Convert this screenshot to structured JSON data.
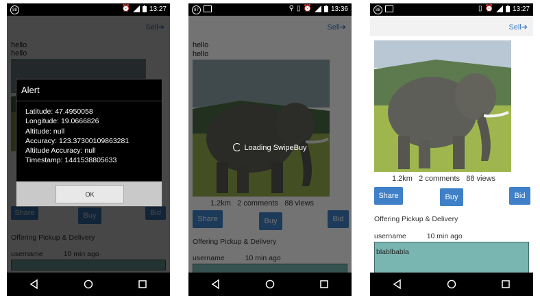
{
  "status": {
    "phone1": {
      "badge": "88",
      "time": "13:27"
    },
    "phone2": {
      "badge": "87",
      "time": "13:36"
    },
    "phone3": {
      "badge": "88",
      "time": "13:27"
    }
  },
  "header": {
    "sell_label": "Sell➔"
  },
  "feed": {
    "hello_lines": [
      "hello",
      "hello"
    ],
    "stats_distance": "1.2km",
    "stats_comments": "2 comments",
    "stats_views": "88 views",
    "share_label": "Share",
    "buy_label": "Buy",
    "bid_label": "Bid",
    "offering": "Offering Pickup & Delivery",
    "username": "username",
    "time_ago": "10 min ago",
    "comment_text": "blablbabla"
  },
  "alert": {
    "title": "Alert",
    "lines": [
      "Latitude: 47.4950058",
      "Longitude: 19.0666826",
      "Altitude: null",
      "Accuracy: 123.37300109863281",
      "Altitude Accuracy: null",
      "Timestamp: 1441538805633"
    ],
    "ok_label": "OK"
  },
  "loading": {
    "text": "Loading SwipeBuy"
  },
  "colors": {
    "accent": "#3f80c8",
    "comment_box": "#79b6b2"
  },
  "icons": [
    "alarm-icon",
    "signal-icon",
    "battery-icon",
    "location-icon",
    "vibrate-icon",
    "image-icon",
    "back-icon",
    "home-icon",
    "recents-icon"
  ]
}
